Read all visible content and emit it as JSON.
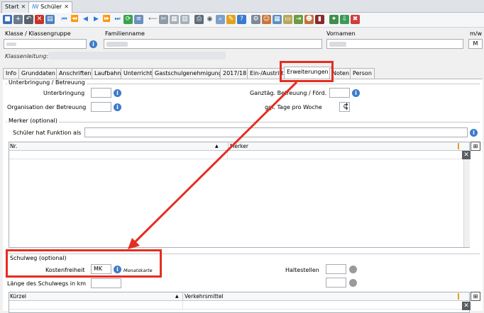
{
  "window_tabs": [
    {
      "label": "Start"
    },
    {
      "label": "Schüler"
    }
  ],
  "header": {
    "klasse_label": "Klasse / Klassengruppe",
    "familienname_label": "Familienname",
    "vornamen_label": "Vornamen",
    "mw_label": "m/w",
    "mw_value": "M",
    "klassenleitung_label": "Klassenleitung:"
  },
  "tabs": [
    "Info",
    "Grunddaten",
    "Anschriften",
    "Laufbahn",
    "Unterricht",
    "Gastschulgenehmigung",
    "2017/18",
    "Ein-/Austritt",
    "Erweiterungen",
    "Noten",
    "Person"
  ],
  "active_tab": "Erweiterungen",
  "unterbringung": {
    "group_title": "Unterbringung / Betreuung",
    "unterbringung_label": "Unterbringung",
    "organisation_label": "Organisation der Betreuung",
    "ganztag_label": "Ganztäg. Betreuung / Förd.",
    "tage_label": "ggf. Tage pro Woche",
    "tage_value": "0"
  },
  "merker": {
    "group_title": "Merker (optional)",
    "funktion_label": "Schüler hat Funktion als",
    "columns": [
      "Nr.",
      "Merker"
    ]
  },
  "schulweg": {
    "group_title": "Schulweg (optional)",
    "kosten_label": "Kostenfreiheit",
    "kosten_value": "MK",
    "kosten_hint": "Monatskarte",
    "haltestellen_label": "Haltestellen",
    "laenge_label": "Länge des Schulwegs in km",
    "columns": [
      "Kürzel",
      "Verkehrsmittel"
    ]
  },
  "colors": {
    "highlight": "#e52d20",
    "info": "#3d7cc9"
  }
}
